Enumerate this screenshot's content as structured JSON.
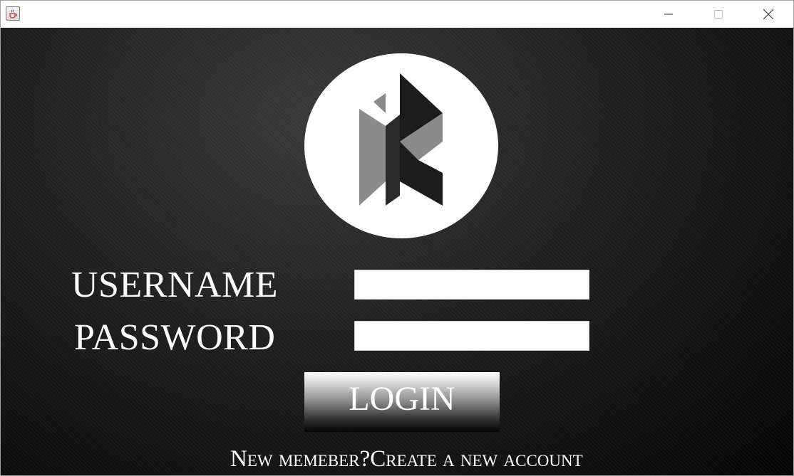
{
  "window": {
    "title_icon": "java-coffee-cup-icon",
    "controls": {
      "minimize_icon": "minimize-icon",
      "maximize_icon": "maximize-icon",
      "close_icon": "close-icon"
    }
  },
  "logo": {
    "icon": "k-logo-icon"
  },
  "form": {
    "username_label": "USERNAME",
    "password_label": "PASSWORD",
    "username_value": "",
    "password_value": "",
    "login_label": "LOGIN",
    "signup_link": "New memeber?Create a new account"
  },
  "colors": {
    "background": "#1a1a1a",
    "text": "#ffffff",
    "logo_dark": "#1c1c1c",
    "logo_gray": "#8a8a8a"
  }
}
